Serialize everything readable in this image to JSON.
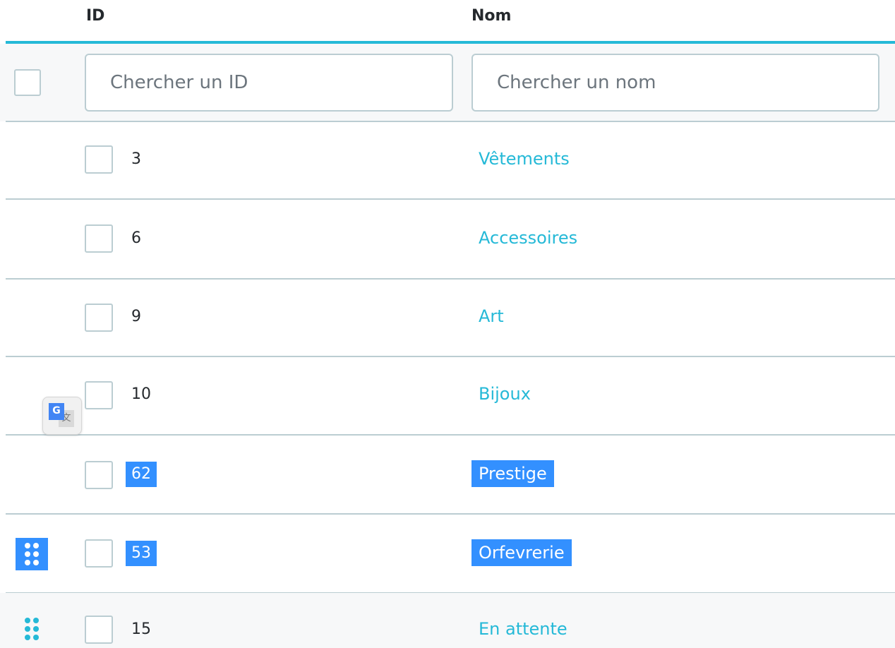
{
  "table": {
    "headers": {
      "id": "ID",
      "name": "Nom"
    },
    "filters": {
      "id_placeholder": "Chercher un ID",
      "name_placeholder": "Chercher un nom"
    },
    "rows": [
      {
        "id": "3",
        "name": "Vêtements",
        "selected": false
      },
      {
        "id": "6",
        "name": "Accessoires",
        "selected": false
      },
      {
        "id": "9",
        "name": "Art",
        "selected": false
      },
      {
        "id": "10",
        "name": "Bijoux",
        "selected": false
      },
      {
        "id": "62",
        "name": "Prestige",
        "selected": true
      },
      {
        "id": "53",
        "name": "Orfevrerie",
        "selected": true
      },
      {
        "id": "15",
        "name": "En attente",
        "selected": false
      }
    ]
  },
  "widgets": {
    "translate_icon": "google-translate-icon",
    "drag_icon": "drag-handle-icon"
  },
  "colors": {
    "accent": "#25b9d7",
    "selection": "#3390ff",
    "border": "#bbcdd2",
    "text": "#25292d"
  }
}
